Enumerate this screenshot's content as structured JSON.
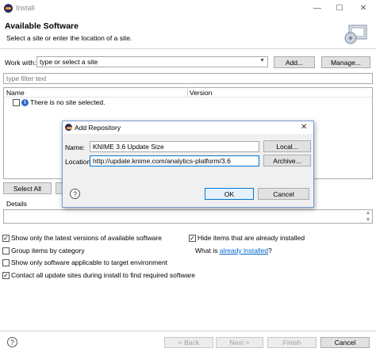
{
  "window": {
    "title": "Install",
    "minimize": "—",
    "maximize": "☐",
    "close": "✕"
  },
  "header": {
    "title": "Available Software",
    "subtitle": "Select a site or enter the location of a site."
  },
  "work_with": {
    "label": "Work with:",
    "value": "type or select a site",
    "add_label": "Add...",
    "manage_label": "Manage..."
  },
  "filter": {
    "placeholder": "type filter text"
  },
  "table": {
    "columns": [
      "Name",
      "Version"
    ],
    "message": "There is no site selected."
  },
  "buttons": {
    "select_all": "Select All"
  },
  "details": {
    "label": "Details"
  },
  "options": {
    "latest_versions": "Show only the latest versions of available software",
    "group_by_category": "Group items by category",
    "target_env": "Show only software applicable to target environment",
    "contact_sites": "Contact all update sites during install to find required software",
    "hide_installed": "Hide items that are already installed",
    "what_is": "What is ",
    "already_installed_link": "already installed",
    "question_mark": "?"
  },
  "option_states": {
    "latest_versions": true,
    "group_by_category": false,
    "target_env": false,
    "contact_sites": true,
    "hide_installed": true
  },
  "footer": {
    "back": "< Back",
    "next": "Next >",
    "finish": "Finish",
    "cancel": "Cancel"
  },
  "dialog": {
    "title": "Add Repository",
    "name_label": "Name:",
    "name_value": "KNIME 3.6 Update Size",
    "location_label": "Location:",
    "location_value": "http://update.knime.com/analytics-platform/3.6",
    "local_label": "Local...",
    "archive_label": "Archive...",
    "ok_label": "OK",
    "cancel_label": "Cancel"
  },
  "colors": {
    "accent_border": "#0078d7",
    "link": "#0066cc",
    "dialog_border": "#7a9bcf"
  }
}
